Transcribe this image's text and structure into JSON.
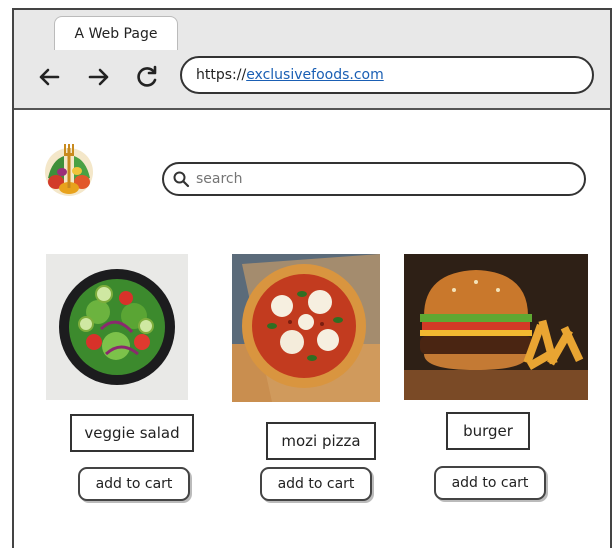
{
  "browser": {
    "tab_title": "A Web Page",
    "url_prefix": "https://",
    "url_link": "exclusivefoods.com"
  },
  "site": {
    "logo_icon": "fork-vegetables-logo-icon",
    "search": {
      "placeholder": "search",
      "icon": "search-icon"
    }
  },
  "products": [
    {
      "name": "veggie salad",
      "button": "add to cart",
      "image": "salad-photo"
    },
    {
      "name": "mozi pizza",
      "button": "add to cart",
      "image": "pizza-photo"
    },
    {
      "name": "burger",
      "button": "add to cart",
      "image": "burger-photo"
    }
  ],
  "colors": {
    "link": "#1a5fb4",
    "chrome": "#e8e8e8",
    "outline": "#333333"
  }
}
